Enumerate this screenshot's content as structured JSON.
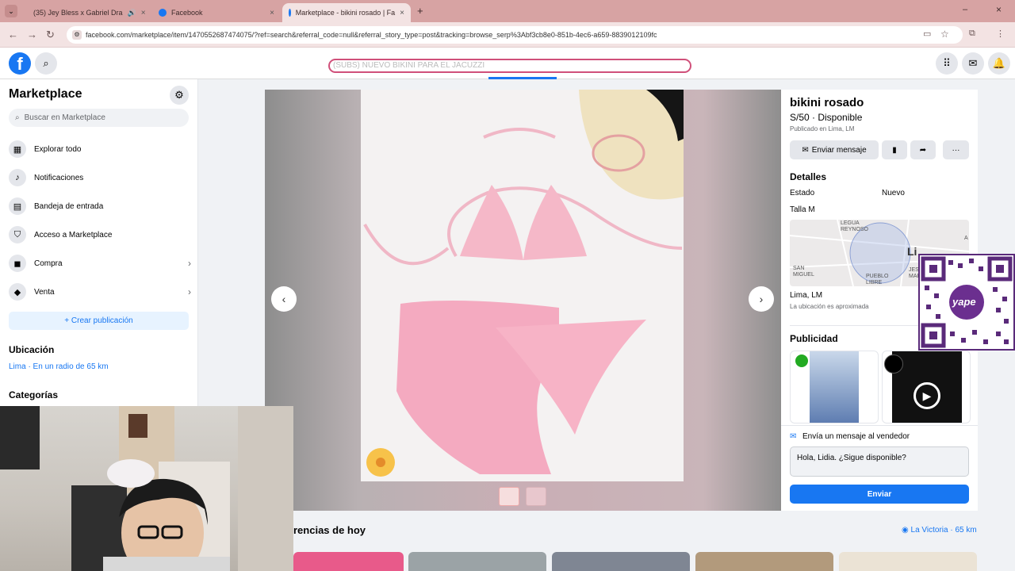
{
  "browser": {
    "tabs": [
      {
        "label": "(35) Jey Bless x Gabriel Dra",
        "active": false
      },
      {
        "label": "Facebook",
        "active": false
      },
      {
        "label": "Marketplace - bikini rosado | Fa",
        "active": true
      }
    ],
    "url": "facebook.com/marketplace/item/1470552687474075/?ref=search&referral_code=null&referral_story_type=post&tracking=browse_serp%3Abf3cb8e0-851b-4ec6-a659-8839012109fc"
  },
  "overlay_banner": "(SUBS) NUEVO BIKINI PARA EL JACUZZI",
  "sidebar": {
    "title": "Marketplace",
    "search_placeholder": "Buscar en Marketplace",
    "items": [
      {
        "label": "Explorar todo",
        "icon": "storefront-icon"
      },
      {
        "label": "Notificaciones",
        "icon": "bell-icon"
      },
      {
        "label": "Bandeja de entrada",
        "icon": "inbox-icon"
      },
      {
        "label": "Acceso a Marketplace",
        "icon": "shield-icon"
      },
      {
        "label": "Compra",
        "icon": "bag-icon"
      },
      {
        "label": "Venta",
        "icon": "tag-icon"
      }
    ],
    "create_label": "+ Crear publicación",
    "location_heading": "Ubicación",
    "location_value": "Lima · En un radio de 65 km",
    "categories_heading": "Categorías"
  },
  "listing": {
    "title": "bikini rosado",
    "price_status": "S/50 · Disponible",
    "published": "Publicado en Lima, LM",
    "message_button": "Enviar mensaje",
    "details_heading": "Detalles",
    "condition_label": "Estado",
    "condition_value": "Nuevo",
    "size": "Talla M",
    "map_labels": [
      "LEGUA REYNOSO",
      "SAN MIGUEL",
      "PUEBLO LIBRE",
      "JESÚ MARI",
      "Li",
      "A"
    ],
    "location": "Lima, LM",
    "location_note": "La ubicación es aproximada",
    "ads_heading": "Publicidad",
    "message_prompt": "Envía un mensaje al vendedor",
    "message_text": "Hola, Lidia. ¿Sigue disponible?",
    "send_label": "Enviar"
  },
  "bottom": {
    "heading": "rencias de hoy",
    "location": "La Victoria · 65 km"
  },
  "qr_brand": "yape",
  "colors": {
    "accent": "#1877f2",
    "tabbar": "#d7a3a3",
    "qr": "#5a2a7a"
  }
}
